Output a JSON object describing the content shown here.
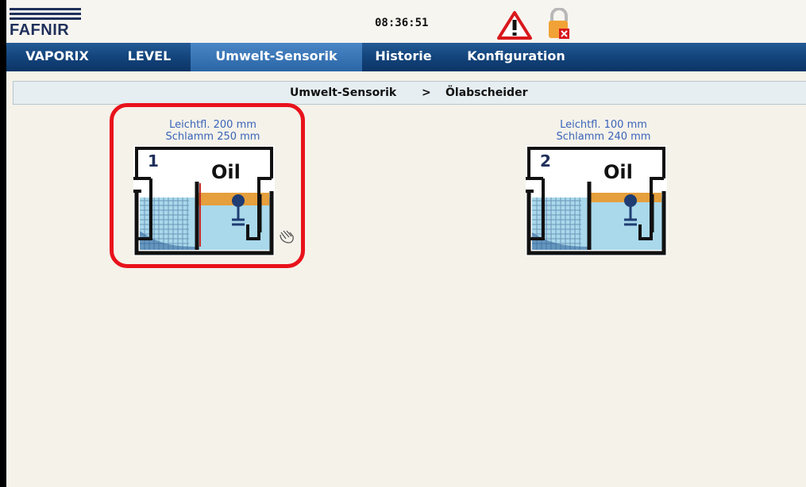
{
  "header": {
    "brand": "FAFNIR",
    "time": "08:36:51",
    "icons": [
      "alarm-warning-icon",
      "lock-icon"
    ]
  },
  "nav": {
    "tabs": [
      {
        "label": "VAPORIX",
        "active": false
      },
      {
        "label": "LEVEL",
        "active": false
      },
      {
        "label": "Umwelt-Sensorik",
        "active": true
      },
      {
        "label": "Historie",
        "active": false
      },
      {
        "label": "Konfiguration",
        "active": false
      }
    ]
  },
  "breadcrumb": {
    "parent": "Umwelt-Sensorik",
    "separator": ">",
    "current": "Ölabscheider"
  },
  "separators": [
    {
      "number": "1",
      "label": "Oil",
      "light_liquid": "Leichtfl. 200 mm",
      "sludge": "Schlamm 250 mm",
      "selected": true
    },
    {
      "number": "2",
      "label": "Oil",
      "light_liquid": "Leichtfl. 100 mm",
      "sludge": "Schlamm 240 mm",
      "selected": false
    }
  ],
  "colors": {
    "nav_bg": "#14467e",
    "nav_active": "#3a76b6",
    "water": "#a8d8ea",
    "oil": "#e59f3c",
    "highlight": "#e8121b",
    "caption": "#3a64b8"
  }
}
